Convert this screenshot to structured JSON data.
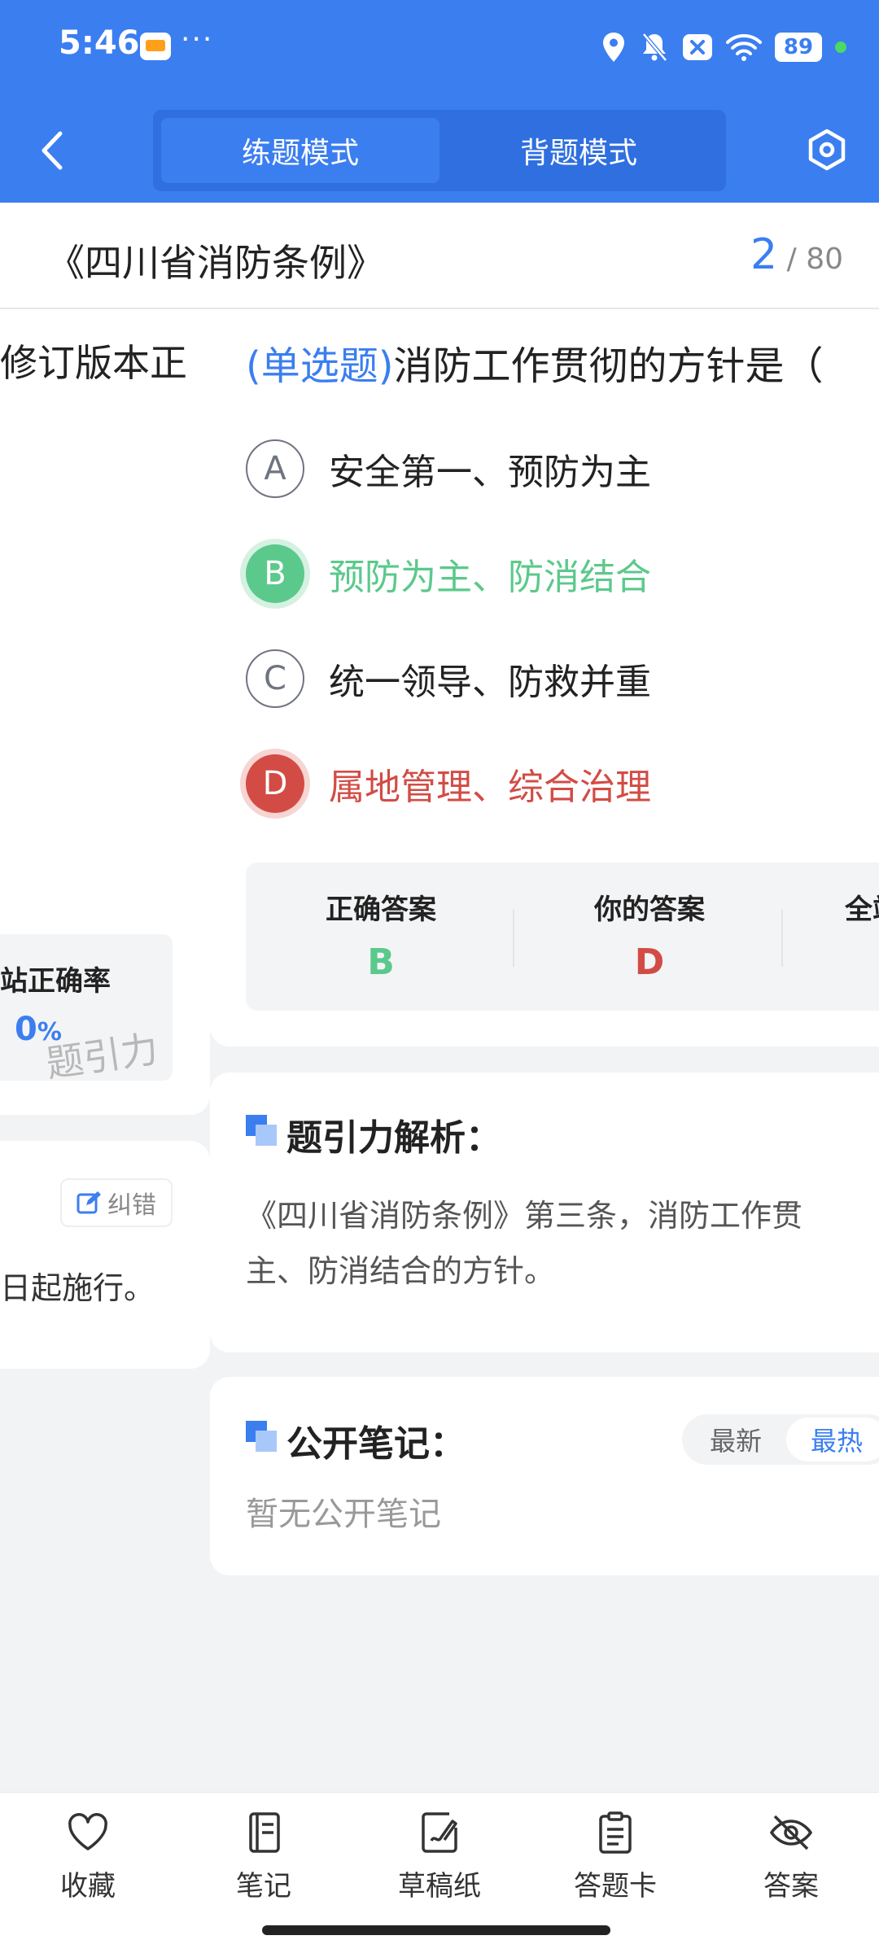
{
  "status_bar": {
    "time": "5:46",
    "more": "···",
    "battery": "89"
  },
  "header": {
    "mode_tabs": [
      {
        "label": "练题模式",
        "active": true
      },
      {
        "label": "背题模式",
        "active": false
      }
    ]
  },
  "title_bar": {
    "title": "《四川省消防条例》",
    "current": "2",
    "separator": "/",
    "total": "80"
  },
  "prev_question": {
    "question_fragment": "修订版本正",
    "stat_label": "站正确率",
    "stat_value": "0",
    "stat_unit": "%",
    "watermark": "题引力",
    "report_label": "纠错",
    "text_fragment": "日起施行。"
  },
  "question": {
    "type_tag": "(单选题)",
    "text": "消防工作贯彻的方针是（",
    "options": [
      {
        "letter": "A",
        "text": "安全第一、预防为主",
        "state": "normal"
      },
      {
        "letter": "B",
        "text": "预防为主、防消结合",
        "state": "correct"
      },
      {
        "letter": "C",
        "text": "统一领导、防救并重",
        "state": "normal"
      },
      {
        "letter": "D",
        "text": "属地管理、综合治理",
        "state": "wrong"
      }
    ]
  },
  "answer": {
    "correct_label": "正确答案",
    "correct_value": "B",
    "your_label": "你的答案",
    "your_value": "D",
    "third_label": "全站"
  },
  "analysis": {
    "title": "题引力解析：",
    "text": "《四川省消防条例》第三条，消防工作贯\n主、防消结合的方针。"
  },
  "notes": {
    "title": "公开笔记：",
    "sort_options": [
      "最新",
      "最热"
    ],
    "active_sort": "最热",
    "empty_text": "暂无公开笔记"
  },
  "bottom_nav": [
    {
      "label": "收藏",
      "icon": "heart-icon"
    },
    {
      "label": "笔记",
      "icon": "notebook-icon"
    },
    {
      "label": "草稿纸",
      "icon": "draft-paper-icon"
    },
    {
      "label": "答题卡",
      "icon": "answer-card-icon"
    },
    {
      "label": "答案",
      "icon": "eye-off-icon"
    }
  ],
  "colors": {
    "primary": "#3b7ef0",
    "correct": "#5bc98b",
    "wrong": "#d24c45"
  }
}
